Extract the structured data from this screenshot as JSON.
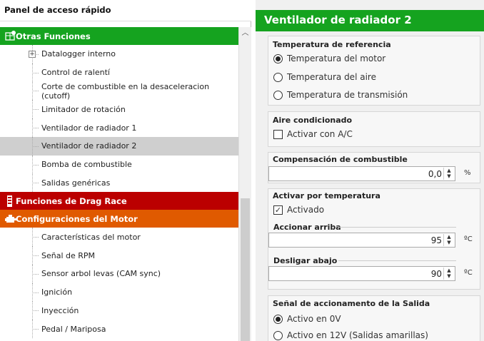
{
  "left_panel": {
    "title": "Panel de acceso rápido",
    "categories": {
      "otras": {
        "label": "Otras Funciones",
        "color": "#15a31f"
      },
      "drag": {
        "label": "Funciones de Drag Race",
        "color": "#bb0000"
      },
      "motor": {
        "label": "Configuraciones del Motor",
        "color": "#e05a00"
      }
    },
    "otras_items": [
      {
        "label": "Datalogger interno"
      },
      {
        "label": "Control de ralentí"
      },
      {
        "label": "Corte de combustible en la desaceleracion (cutoff)"
      },
      {
        "label": "Limitador de rotación"
      },
      {
        "label": "Ventilador de radiador 1"
      },
      {
        "label": "Ventilador de radiador 2"
      },
      {
        "label": "Bomba de combustible"
      },
      {
        "label": "Salidas genéricas"
      }
    ],
    "motor_items": [
      {
        "label": "Características del motor"
      },
      {
        "label": "Señal de RPM"
      },
      {
        "label": "Sensor arbol levas (CAM sync)"
      },
      {
        "label": "Ignición"
      },
      {
        "label": "Inyección"
      },
      {
        "label": "Pedal / Mariposa"
      }
    ]
  },
  "right_panel": {
    "title": "Ventilador de radiador 2",
    "temp_ref": {
      "title": "Temperatura de referencia",
      "options": [
        "Temperatura del motor",
        "Temperatura del aire",
        "Temperatura de transmisión"
      ]
    },
    "ac": {
      "title": "Aire condicionado",
      "checkbox": "Activar con A/C"
    },
    "fuel_comp": {
      "title": "Compensación de combustible",
      "value": "0,0",
      "unit": "%"
    },
    "activate": {
      "title": "Activar por temperatura",
      "checkbox": "Activado",
      "on_label": "Accionar arriba",
      "on_value": "95",
      "off_label": "Desligar abajo",
      "off_value": "90",
      "unit": "ºC"
    },
    "output_signal": {
      "title": "Señal de accionamento de la Salida",
      "options": [
        "Activo en 0V",
        "Activo en 12V (Salidas amarillas)"
      ]
    }
  }
}
